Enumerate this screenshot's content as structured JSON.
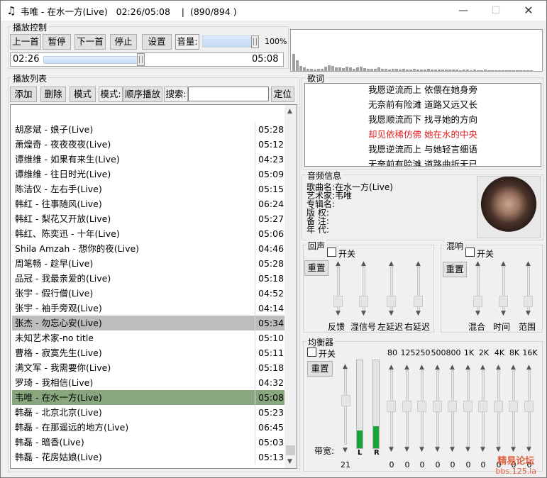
{
  "window": {
    "title": "韦唯 - 在水一方(Live)   02:26/05:08    |  (890/894 )",
    "minimize_glyph": "—",
    "maximize_glyph": "☐",
    "close_glyph": "✕"
  },
  "playback": {
    "group_label": "播放控制",
    "prev": "上一首",
    "pause": "暂停",
    "next": "下一首",
    "stop": "停止",
    "settings": "设置",
    "volume_label": "音量:",
    "volume_value": "100%",
    "volume_fraction": 1.0,
    "elapsed": "02:26",
    "total": "05:08",
    "progress_fraction": 0.474
  },
  "spectrum_levels": [
    0.42,
    0.25,
    0.12,
    0.08,
    0.06,
    0.05,
    0.04,
    0.05,
    0.06,
    0.1,
    0.14,
    0.12,
    0.09,
    0.08,
    0.07,
    0.1,
    0.08,
    0.06,
    0.09,
    0.1,
    0.07,
    0.06,
    0.05,
    0.06,
    0.08,
    0.06,
    0.05,
    0.04,
    0.05,
    0.06,
    0.04,
    0.05,
    0.03,
    0.04,
    0.05,
    0.03,
    0.04,
    0.03,
    0.05,
    0.04,
    0.03,
    0.04,
    0.03,
    0.03,
    0.04,
    0.03,
    0.03,
    0.02,
    0.03,
    0.03,
    0.02,
    0.03,
    0.02,
    0.02,
    0.03,
    0.02,
    0.02,
    0.02,
    0.02,
    0.02,
    0.02,
    0.02,
    0.02,
    0.02,
    0.02,
    0.02,
    0.02,
    0.02
  ],
  "playlist": {
    "group_label": "播放列表",
    "add": "添加",
    "delete": "删除",
    "mode_btn": "模式",
    "mode_label": "模式:",
    "mode_value": "顺序播放",
    "search_label": "搜索:",
    "search_value": "",
    "locate": "定位",
    "rows": [
      {
        "name": "胡彦斌 - 娘子(Live)",
        "dur": "05:28"
      },
      {
        "name": "萧煌奇 - 夜夜夜夜(Live)",
        "dur": "05:12"
      },
      {
        "name": "谭维维 - 如果有来生(Live)",
        "dur": "04:23"
      },
      {
        "name": "谭维维 - 往日时光(Live)",
        "dur": "05:09"
      },
      {
        "name": "陈洁仪 - 左右手(Live)",
        "dur": "05:15"
      },
      {
        "name": "韩红 - 往事随风(Live)",
        "dur": "06:24"
      },
      {
        "name": "韩红 - 梨花又开放(Live)",
        "dur": "05:27"
      },
      {
        "name": "韩红、陈奕迅 - 十年(Live)",
        "dur": "05:06"
      },
      {
        "name": "Shila Amzah - 想你的夜(Live)",
        "dur": "04:46"
      },
      {
        "name": "周笔畅 - 趁早(Live)",
        "dur": "05:28"
      },
      {
        "name": "品冠 - 我最亲爱的(Live)",
        "dur": "05:18"
      },
      {
        "name": "张宇 - 假行僧(Live)",
        "dur": "04:52"
      },
      {
        "name": "张宇 - 袖手旁观(Live)",
        "dur": "04:14"
      },
      {
        "name": "张杰 - 勿忘心安(Live)",
        "dur": "05:34"
      },
      {
        "name": "未知艺术家-no title",
        "dur": "05:10"
      },
      {
        "name": "曹格 - 寂寞先生(Live)",
        "dur": "05:11"
      },
      {
        "name": "满文军 - 我需要你(Live)",
        "dur": "05:18"
      },
      {
        "name": "罗琦 - 我相信(Live)",
        "dur": "04:32"
      },
      {
        "name": "韦唯 - 在水一方(Live)",
        "dur": "05:08"
      },
      {
        "name": "韩磊 - 北京北京(Live)",
        "dur": "05:23"
      },
      {
        "name": "韩磊 - 在那遥远的地方(Live)",
        "dur": "06:45"
      },
      {
        "name": "韩磊 - 暗香(Live)",
        "dur": "05:03"
      },
      {
        "name": "韩磊 - 花房姑娘(Live)",
        "dur": "05:13"
      }
    ],
    "selected_index": 13,
    "playing_index": 18
  },
  "lyrics": {
    "group_label": "歌词",
    "lines": [
      "我愿逆流而上 依偎在她身旁",
      "无奈前有险滩 道路又远又长",
      "我愿顺流而下 找寻她的方向",
      "却见依稀仿佛 她在水的中央",
      "我愿逆流而上 与她轻言细语",
      "无奈前有险滩 道路曲折无已"
    ],
    "current_index": 3
  },
  "info": {
    "group_label": "音频信息",
    "title_line": "歌曲名:在水一方(Live)",
    "artist_line": "艺术家:韦唯",
    "album_line": "专辑名:",
    "copyright_line": "版  权:",
    "comment_line": "备  注:",
    "year_line": "年  代:"
  },
  "echo": {
    "group_label": "回声",
    "enable_label": "开关",
    "reset": "重置",
    "labels": [
      "反馈",
      "湿信号",
      "左延迟",
      "右延迟"
    ]
  },
  "reverb": {
    "group_label": "混响",
    "enable_label": "开关",
    "reset": "重置",
    "labels": [
      "混合",
      "时间",
      "范围"
    ]
  },
  "eq": {
    "group_label": "均衡器",
    "enable_label": "开关",
    "reset": "重置",
    "bandwidth_label": "带宽:",
    "bandwidth_value": "21",
    "meter_l": "L",
    "meter_r": "R",
    "level_l": 0.2,
    "level_r": 0.25,
    "bands": [
      "80",
      "125",
      "250",
      "500",
      "800",
      "1K",
      "2K",
      "4K",
      "8K",
      "16K"
    ],
    "band_values": [
      "0",
      "0",
      "0",
      "0",
      "0",
      "0",
      "0",
      "0",
      "0",
      "0"
    ]
  },
  "watermark": {
    "line1": "精易论坛",
    "line2": "bbs.125.la"
  }
}
